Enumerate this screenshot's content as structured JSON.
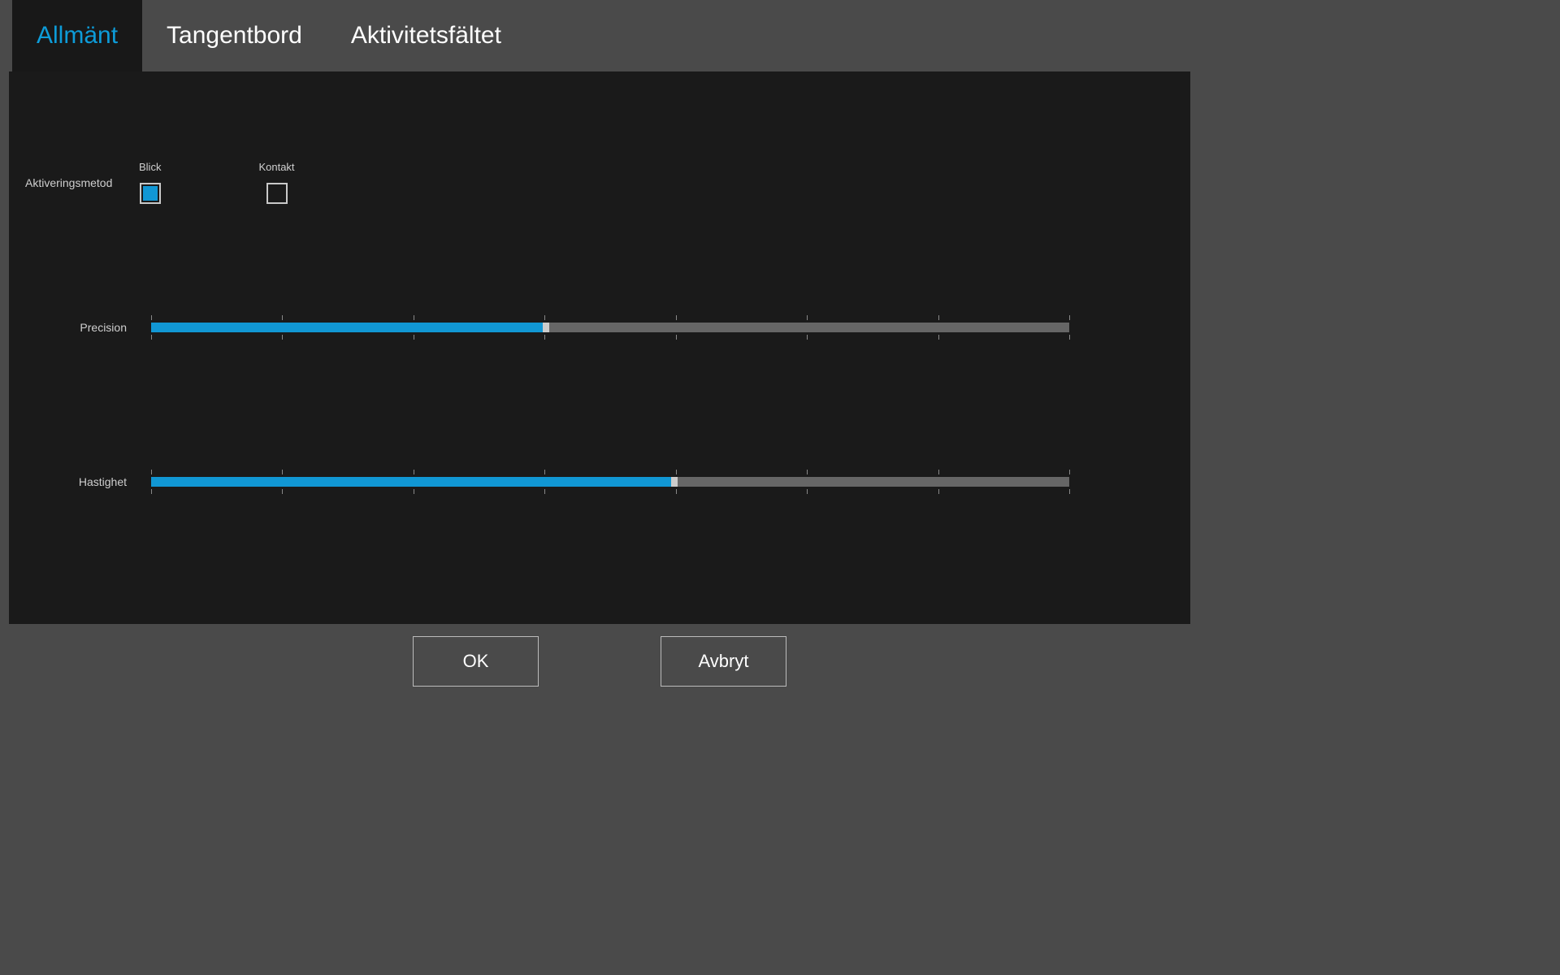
{
  "tabs": [
    {
      "label": "Allmänt",
      "active": true
    },
    {
      "label": "Tangentbord",
      "active": false
    },
    {
      "label": "Aktivitetsfältet",
      "active": false
    }
  ],
  "activation": {
    "label": "Aktiveringsmetod",
    "options": [
      {
        "label": "Blick",
        "checked": true
      },
      {
        "label": "Kontakt",
        "checked": false
      }
    ]
  },
  "sliders": {
    "precision": {
      "label": "Precision",
      "value": 43,
      "ticks": 8
    },
    "speed": {
      "label": "Hastighet",
      "value": 57,
      "ticks": 8
    }
  },
  "buttons": {
    "ok": "OK",
    "cancel": "Avbryt"
  }
}
